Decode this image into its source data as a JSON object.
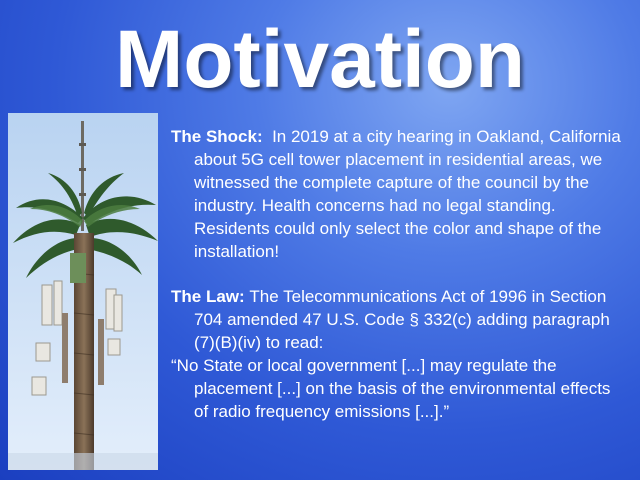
{
  "slide": {
    "title": "Motivation",
    "shock": {
      "heading": "The Shock:",
      "text": "In 2019 at a city hearing in Oakland, California about 5G cell tower placement in residential areas, we witnessed the complete capture of the council by the industry. Health concerns had no legal standing. Residents could only select the color and shape of the installation!"
    },
    "law": {
      "heading": "The Law:",
      "text": "The Telecommunications Act of 1996 in Section 704 amended 47 U.S. Code § 332(c) adding paragraph (7)(B)(iv) to read:"
    },
    "quote": "“No State or local government [...] may regulate the placement [...] on the basis of the environmental effects of radio frequency emissions [...].”"
  }
}
